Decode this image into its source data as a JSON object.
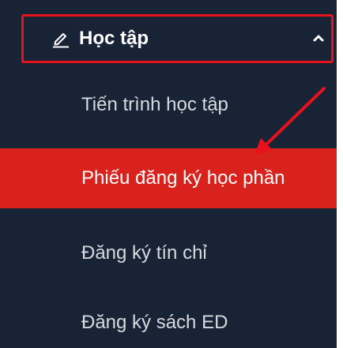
{
  "menu": {
    "section": {
      "label": "Học tập",
      "icon": "pencil-icon",
      "toggle_icon": "chevron-up-icon"
    },
    "items": [
      {
        "label": "Tiến trình học tập"
      },
      {
        "label": "Phiếu đăng ký học phần",
        "active": true
      },
      {
        "label": "Đăng ký tín chỉ"
      },
      {
        "label": "Đăng ký sách ED"
      }
    ]
  },
  "colors": {
    "sidebar_bg": "#182335",
    "highlight_box": "#e8121c",
    "active_item_bg": "#d9221c",
    "annotation_arrow": "#e8121c",
    "text": "#ffffff"
  }
}
